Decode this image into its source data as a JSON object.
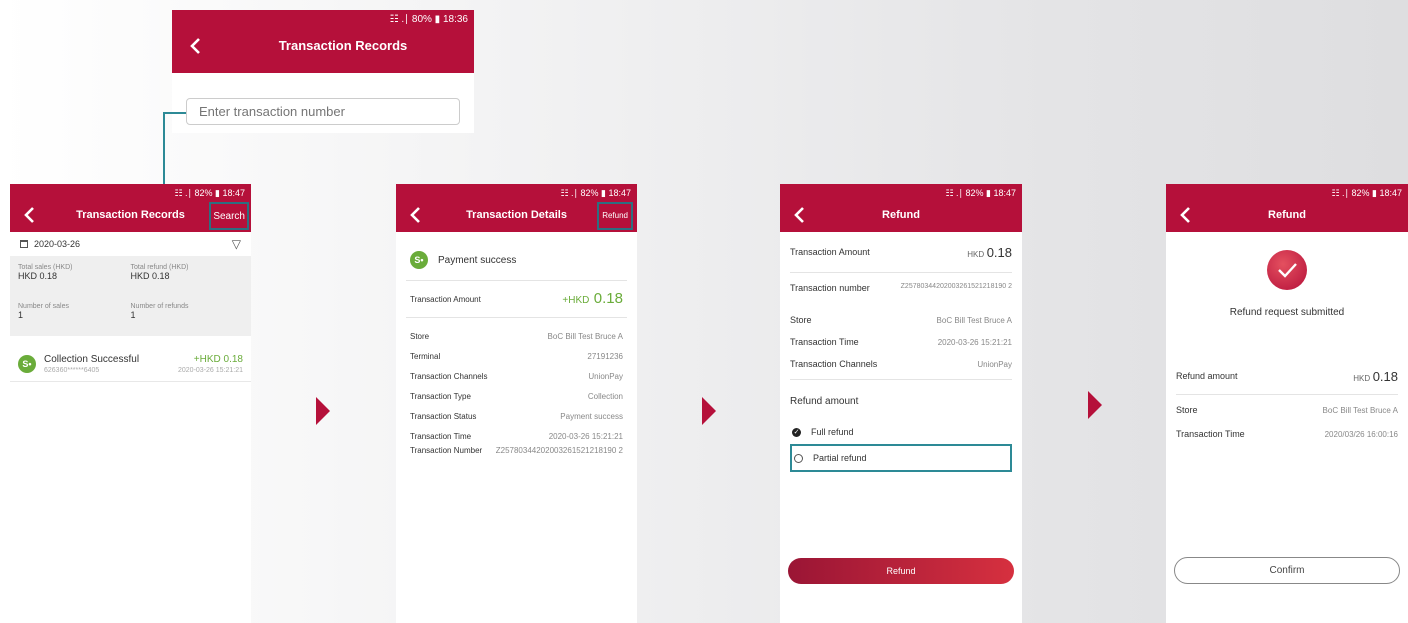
{
  "colors": {
    "brand": "#b5103a",
    "success": "#6aac3a",
    "highlight": "#2d6f80"
  },
  "search_screen": {
    "status": "☷ .∣ 80% ▮ 18:36",
    "title": "Transaction Records",
    "placeholder": "Enter transaction number"
  },
  "records_screen": {
    "status": "☷ .∣ 82% ▮ 18:47",
    "title": "Transaction Records",
    "action": "Search",
    "date": "2020-03-26",
    "stats": [
      {
        "label": "Total sales (HKD)",
        "value": "HKD 0.18"
      },
      {
        "label": "Total refund (HKD)",
        "value": "HKD 0.18"
      },
      {
        "label": "Number of sales",
        "value": "1"
      },
      {
        "label": "Number of refunds",
        "value": "1"
      }
    ],
    "item": {
      "title": "Collection Successful",
      "amount": "+HKD 0.18",
      "card": "626360******6405",
      "time": "2020-03-26 15:21:21"
    }
  },
  "details_screen": {
    "status": "☷ .∣ 82% ▮ 18:47",
    "title": "Transaction Details",
    "action": "Refund",
    "status_text": "Payment success",
    "amount_label": "Transaction Amount",
    "amount_prefix": "+HKD",
    "amount_value": "0.18",
    "rows": [
      {
        "label": "Store",
        "value": "BoC Bill Test Bruce A"
      },
      {
        "label": "Terminal",
        "value": "27191236"
      },
      {
        "label": "Transaction Channels",
        "value": "UnionPay"
      },
      {
        "label": "Transaction Type",
        "value": "Collection"
      },
      {
        "label": "Transaction Status",
        "value": "Payment success"
      },
      {
        "label": "Transaction Time",
        "value": "2020-03-26 15:21:21"
      },
      {
        "label": "Transaction Number",
        "value": "Z25780344202003261521218190 2"
      }
    ]
  },
  "refund_screen": {
    "status": "☷ .∣ 82% ▮ 18:47",
    "title": "Refund",
    "amount_label": "Transaction Amount",
    "amount_prefix": "HKD",
    "amount_value": "0.18",
    "rows": [
      {
        "label": "Transaction number",
        "value": "Z25780344202003261521218190 2"
      },
      {
        "label": "Store",
        "value": "BoC Bill Test Bruce A"
      },
      {
        "label": "Transaction Time",
        "value": "2020-03-26 15:21:21"
      },
      {
        "label": "Transaction Channels",
        "value": "UnionPay"
      }
    ],
    "refund_amount_label": "Refund amount",
    "options": [
      "Full refund",
      "Partial refund"
    ],
    "selected": "Full refund",
    "button": "Refund"
  },
  "success_screen": {
    "status": "☷ .∣ 82% ▮ 18:47",
    "title": "Refund",
    "message": "Refund request submitted",
    "amount_label": "Refund amount",
    "amount_prefix": "HKD",
    "amount_value": "0.18",
    "rows": [
      {
        "label": "Store",
        "value": "BoC Bill Test Bruce A"
      },
      {
        "label": "Transaction Time",
        "value": "2020/03/26 16:00:16"
      }
    ],
    "button": "Confirm"
  }
}
